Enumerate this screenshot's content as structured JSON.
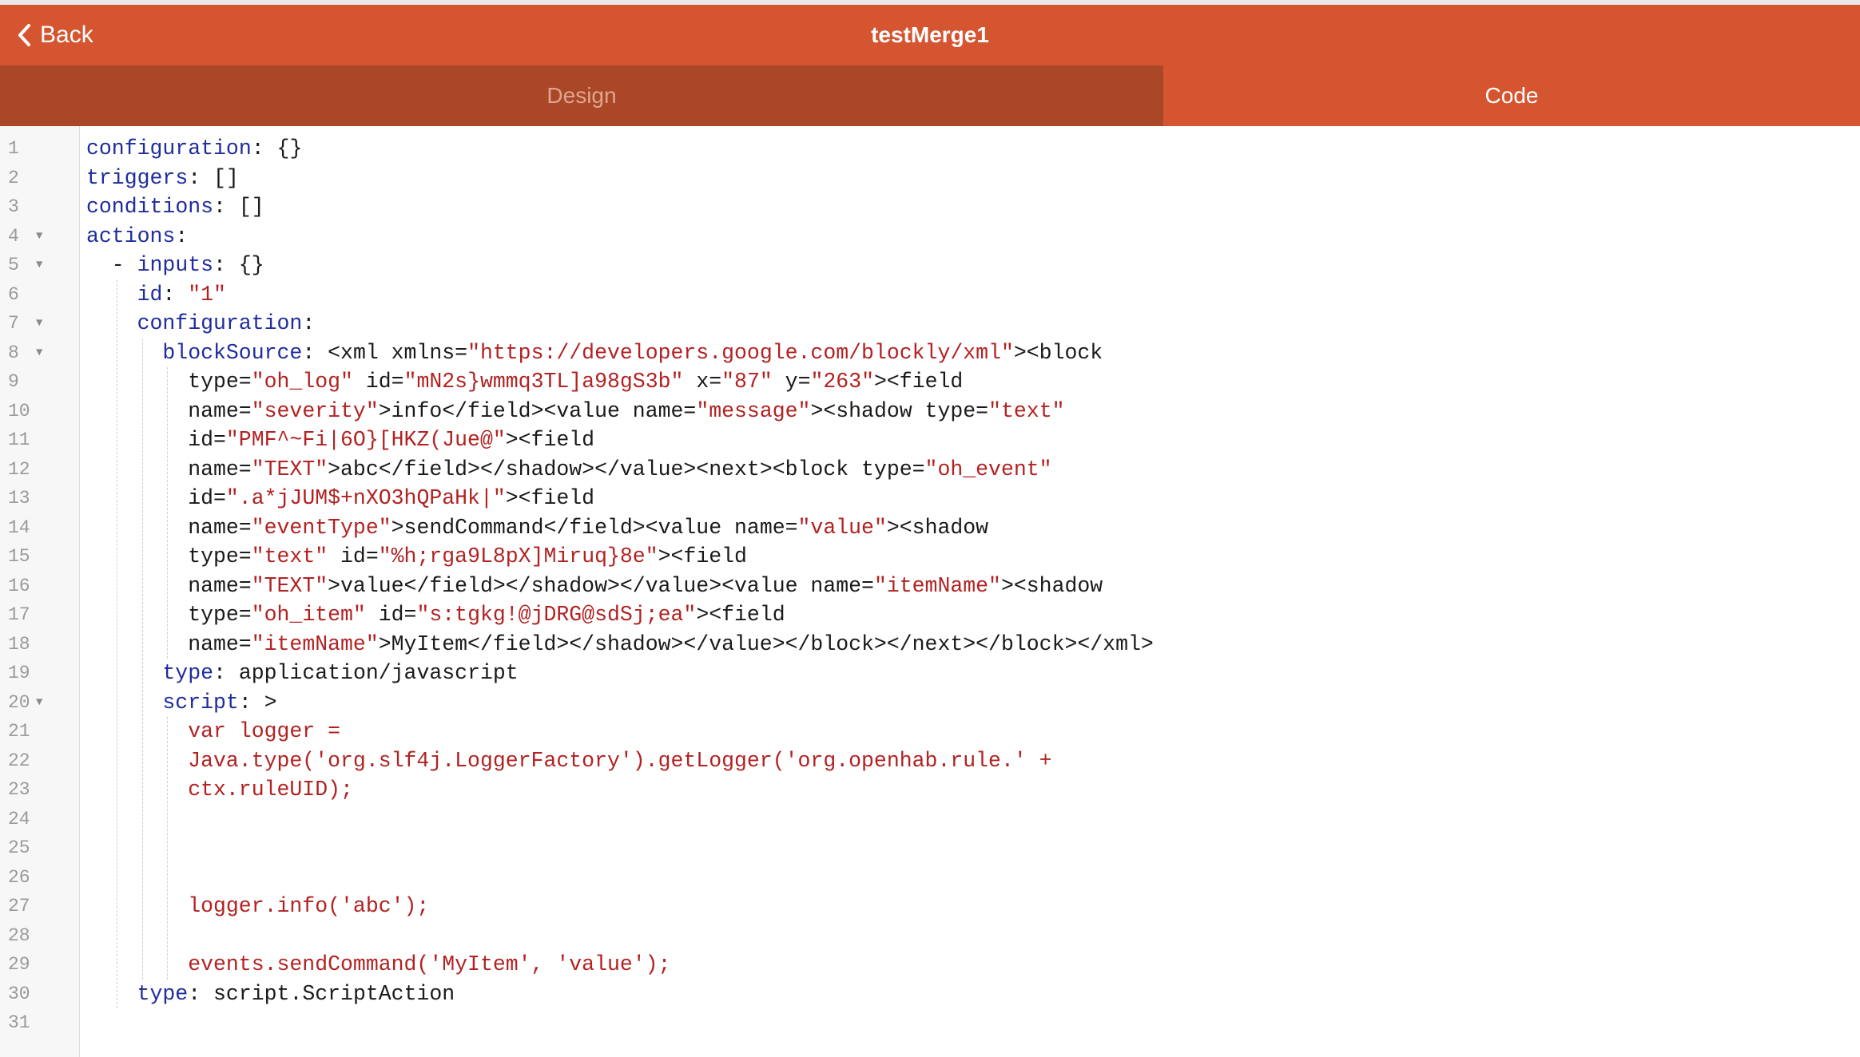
{
  "header": {
    "back_label": "Back",
    "title": "testMerge1"
  },
  "tabs": [
    {
      "label": "Design",
      "active": false
    },
    {
      "label": "Code",
      "active": true
    }
  ],
  "colors": {
    "navbar": "#d65531",
    "inactive_tab": "#a94726",
    "key": "#1f2c9c",
    "string": "#b22222"
  },
  "editor": {
    "lines": [
      {
        "num": "1",
        "fold": false,
        "indent": 0,
        "parts": [
          {
            "t": "configuration",
            "c": "key"
          },
          {
            "t": ": {}",
            "c": ""
          }
        ]
      },
      {
        "num": "2",
        "fold": false,
        "indent": 0,
        "parts": [
          {
            "t": "triggers",
            "c": "key"
          },
          {
            "t": ": []",
            "c": ""
          }
        ]
      },
      {
        "num": "3",
        "fold": false,
        "indent": 0,
        "parts": [
          {
            "t": "conditions",
            "c": "key"
          },
          {
            "t": ": []",
            "c": ""
          }
        ]
      },
      {
        "num": "4",
        "fold": true,
        "indent": 0,
        "parts": [
          {
            "t": "actions",
            "c": "key"
          },
          {
            "t": ":",
            "c": ""
          }
        ]
      },
      {
        "num": "5",
        "fold": true,
        "indent": 1,
        "parts": [
          {
            "t": "- ",
            "c": ""
          },
          {
            "t": "inputs",
            "c": "key"
          },
          {
            "t": ": {}",
            "c": ""
          }
        ]
      },
      {
        "num": "6",
        "fold": false,
        "indent": 2,
        "parts": [
          {
            "t": "id",
            "c": "key"
          },
          {
            "t": ": ",
            "c": ""
          },
          {
            "t": "\"1\"",
            "c": "str"
          }
        ]
      },
      {
        "num": "7",
        "fold": true,
        "indent": 2,
        "parts": [
          {
            "t": "configuration",
            "c": "key"
          },
          {
            "t": ":",
            "c": ""
          }
        ]
      },
      {
        "num": "8",
        "fold": true,
        "indent": 3,
        "parts": [
          {
            "t": "blockSource",
            "c": "key"
          },
          {
            "t": ": <xml xmlns=",
            "c": ""
          },
          {
            "t": "\"https://developers.google.com/blockly/xml\"",
            "c": "str"
          },
          {
            "t": "><block",
            "c": ""
          }
        ]
      },
      {
        "num": "9",
        "fold": false,
        "indent": 4,
        "parts": [
          {
            "t": "type=",
            "c": ""
          },
          {
            "t": "\"oh_log\"",
            "c": "str"
          },
          {
            "t": " id=",
            "c": ""
          },
          {
            "t": "\"mN2s}wmmq3TL]a98gS3b\"",
            "c": "str"
          },
          {
            "t": " x=",
            "c": ""
          },
          {
            "t": "\"87\"",
            "c": "str"
          },
          {
            "t": " y=",
            "c": ""
          },
          {
            "t": "\"263\"",
            "c": "str"
          },
          {
            "t": "><field",
            "c": ""
          }
        ]
      },
      {
        "num": "10",
        "fold": false,
        "indent": 4,
        "parts": [
          {
            "t": "name=",
            "c": ""
          },
          {
            "t": "\"severity\"",
            "c": "str"
          },
          {
            "t": ">info</field><value name=",
            "c": ""
          },
          {
            "t": "\"message\"",
            "c": "str"
          },
          {
            "t": "><shadow type=",
            "c": ""
          },
          {
            "t": "\"text\"",
            "c": "str"
          }
        ]
      },
      {
        "num": "11",
        "fold": false,
        "indent": 4,
        "parts": [
          {
            "t": "id=",
            "c": ""
          },
          {
            "t": "\"PMF^~Fi|6O}[HKZ(Jue@\"",
            "c": "str"
          },
          {
            "t": "><field",
            "c": ""
          }
        ]
      },
      {
        "num": "12",
        "fold": false,
        "indent": 4,
        "parts": [
          {
            "t": "name=",
            "c": ""
          },
          {
            "t": "\"TEXT\"",
            "c": "str"
          },
          {
            "t": ">abc</field></shadow></value><next><block type=",
            "c": ""
          },
          {
            "t": "\"oh_event\"",
            "c": "str"
          }
        ]
      },
      {
        "num": "13",
        "fold": false,
        "indent": 4,
        "parts": [
          {
            "t": "id=",
            "c": ""
          },
          {
            "t": "\".a*jJUM$+nXO3hQPaHk|\"",
            "c": "str"
          },
          {
            "t": "><field",
            "c": ""
          }
        ]
      },
      {
        "num": "14",
        "fold": false,
        "indent": 4,
        "parts": [
          {
            "t": "name=",
            "c": ""
          },
          {
            "t": "\"eventType\"",
            "c": "str"
          },
          {
            "t": ">sendCommand</field><value name=",
            "c": ""
          },
          {
            "t": "\"value\"",
            "c": "str"
          },
          {
            "t": "><shadow",
            "c": ""
          }
        ]
      },
      {
        "num": "15",
        "fold": false,
        "indent": 4,
        "parts": [
          {
            "t": "type=",
            "c": ""
          },
          {
            "t": "\"text\"",
            "c": "str"
          },
          {
            "t": " id=",
            "c": ""
          },
          {
            "t": "\"%h;rga9L8pX]Miruq}8e\"",
            "c": "str"
          },
          {
            "t": "><field",
            "c": ""
          }
        ]
      },
      {
        "num": "16",
        "fold": false,
        "indent": 4,
        "parts": [
          {
            "t": "name=",
            "c": ""
          },
          {
            "t": "\"TEXT\"",
            "c": "str"
          },
          {
            "t": ">value</field></shadow></value><value name=",
            "c": ""
          },
          {
            "t": "\"itemName\"",
            "c": "str"
          },
          {
            "t": "><shadow",
            "c": ""
          }
        ]
      },
      {
        "num": "17",
        "fold": false,
        "indent": 4,
        "parts": [
          {
            "t": "type=",
            "c": ""
          },
          {
            "t": "\"oh_item\"",
            "c": "str"
          },
          {
            "t": " id=",
            "c": ""
          },
          {
            "t": "\"s:tgkg!@jDRG@sdSj;ea\"",
            "c": "str"
          },
          {
            "t": "><field",
            "c": ""
          }
        ]
      },
      {
        "num": "18",
        "fold": false,
        "indent": 4,
        "parts": [
          {
            "t": "name=",
            "c": ""
          },
          {
            "t": "\"itemName\"",
            "c": "str"
          },
          {
            "t": ">MyItem</field></shadow></value></block></next></block></xml>",
            "c": ""
          }
        ]
      },
      {
        "num": "19",
        "fold": false,
        "indent": 3,
        "parts": [
          {
            "t": "type",
            "c": "key"
          },
          {
            "t": ": application/javascript",
            "c": ""
          }
        ]
      },
      {
        "num": "20",
        "fold": true,
        "indent": 3,
        "parts": [
          {
            "t": "script",
            "c": "key"
          },
          {
            "t": ": >",
            "c": ""
          }
        ]
      },
      {
        "num": "21",
        "fold": false,
        "indent": 4,
        "parts": [
          {
            "t": "var logger =",
            "c": "str"
          }
        ]
      },
      {
        "num": "22",
        "fold": false,
        "indent": 4,
        "parts": [
          {
            "t": "Java.type('org.slf4j.LoggerFactory').getLogger('org.openhab.rule.' +",
            "c": "str"
          }
        ]
      },
      {
        "num": "23",
        "fold": false,
        "indent": 4,
        "parts": [
          {
            "t": "ctx.ruleUID);",
            "c": "str"
          }
        ]
      },
      {
        "num": "24",
        "fold": false,
        "indent": 0,
        "parts": []
      },
      {
        "num": "25",
        "fold": false,
        "indent": 0,
        "parts": []
      },
      {
        "num": "26",
        "fold": false,
        "indent": 0,
        "parts": []
      },
      {
        "num": "27",
        "fold": false,
        "indent": 4,
        "parts": [
          {
            "t": "logger.info('abc');",
            "c": "str"
          }
        ]
      },
      {
        "num": "28",
        "fold": false,
        "indent": 0,
        "parts": []
      },
      {
        "num": "29",
        "fold": false,
        "indent": 4,
        "parts": [
          {
            "t": "events.sendCommand('MyItem', 'value');",
            "c": "str"
          }
        ]
      },
      {
        "num": "30",
        "fold": false,
        "indent": 2,
        "parts": [
          {
            "t": "type",
            "c": "key"
          },
          {
            "t": ": script.ScriptAction",
            "c": ""
          }
        ]
      },
      {
        "num": "31",
        "fold": false,
        "indent": 0,
        "parts": []
      }
    ]
  }
}
